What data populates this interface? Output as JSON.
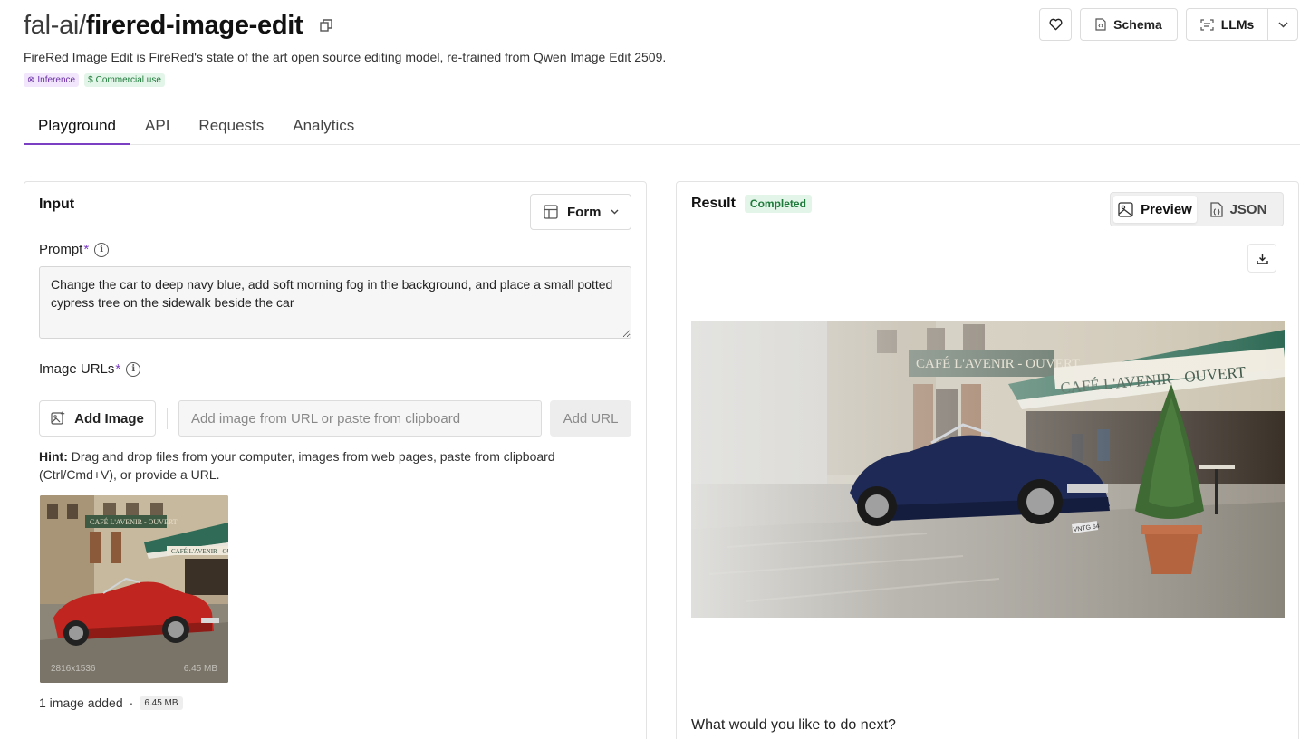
{
  "header": {
    "owner": "fal-ai/",
    "model": "firered-image-edit",
    "description": "FireRed Image Edit is FireRed's state of the art open source editing model, re-trained from Qwen Image Edit 2509.",
    "badges": {
      "inference": "Inference",
      "commercial": "Commercial use"
    },
    "actions": {
      "schema": "Schema",
      "llms": "LLMs"
    }
  },
  "tabs": [
    "Playground",
    "API",
    "Requests",
    "Analytics"
  ],
  "input": {
    "title": "Input",
    "mode_select": "Form",
    "prompt_label": "Prompt",
    "prompt_value": "Change the car to deep navy blue, add soft morning fog in the background, and place a small potted cypress tree on the sidewalk beside the car",
    "image_urls_label": "Image URLs",
    "add_image_label": "Add Image",
    "url_placeholder": "Add image from URL or paste from clipboard",
    "add_url_label": "Add URL",
    "hint_strong": "Hint:",
    "hint_text": " Drag and drop files from your computer, images from web pages, paste from clipboard (Ctrl/Cmd+V), or provide a URL.",
    "thumb_dimensions": "2816x1536",
    "thumb_size": "6.45 MB",
    "added_text": "1 image added",
    "added_sep": "·",
    "added_size": "6.45 MB"
  },
  "result": {
    "title": "Result",
    "status": "Completed",
    "views": {
      "preview": "Preview",
      "json": "JSON"
    },
    "next_question": "What would you like to do next?",
    "image_signs": {
      "facade": "CAFÉ L'AVENIR - OUVERT",
      "awning": "CAFÉ L'AVENIR - OUVERT",
      "plate": "VNTG 64"
    }
  },
  "colors": {
    "accent": "#7b3fc4",
    "completed": "#1d7a3a",
    "car_original": "#c0261f",
    "car_result": "#1e2a55"
  }
}
